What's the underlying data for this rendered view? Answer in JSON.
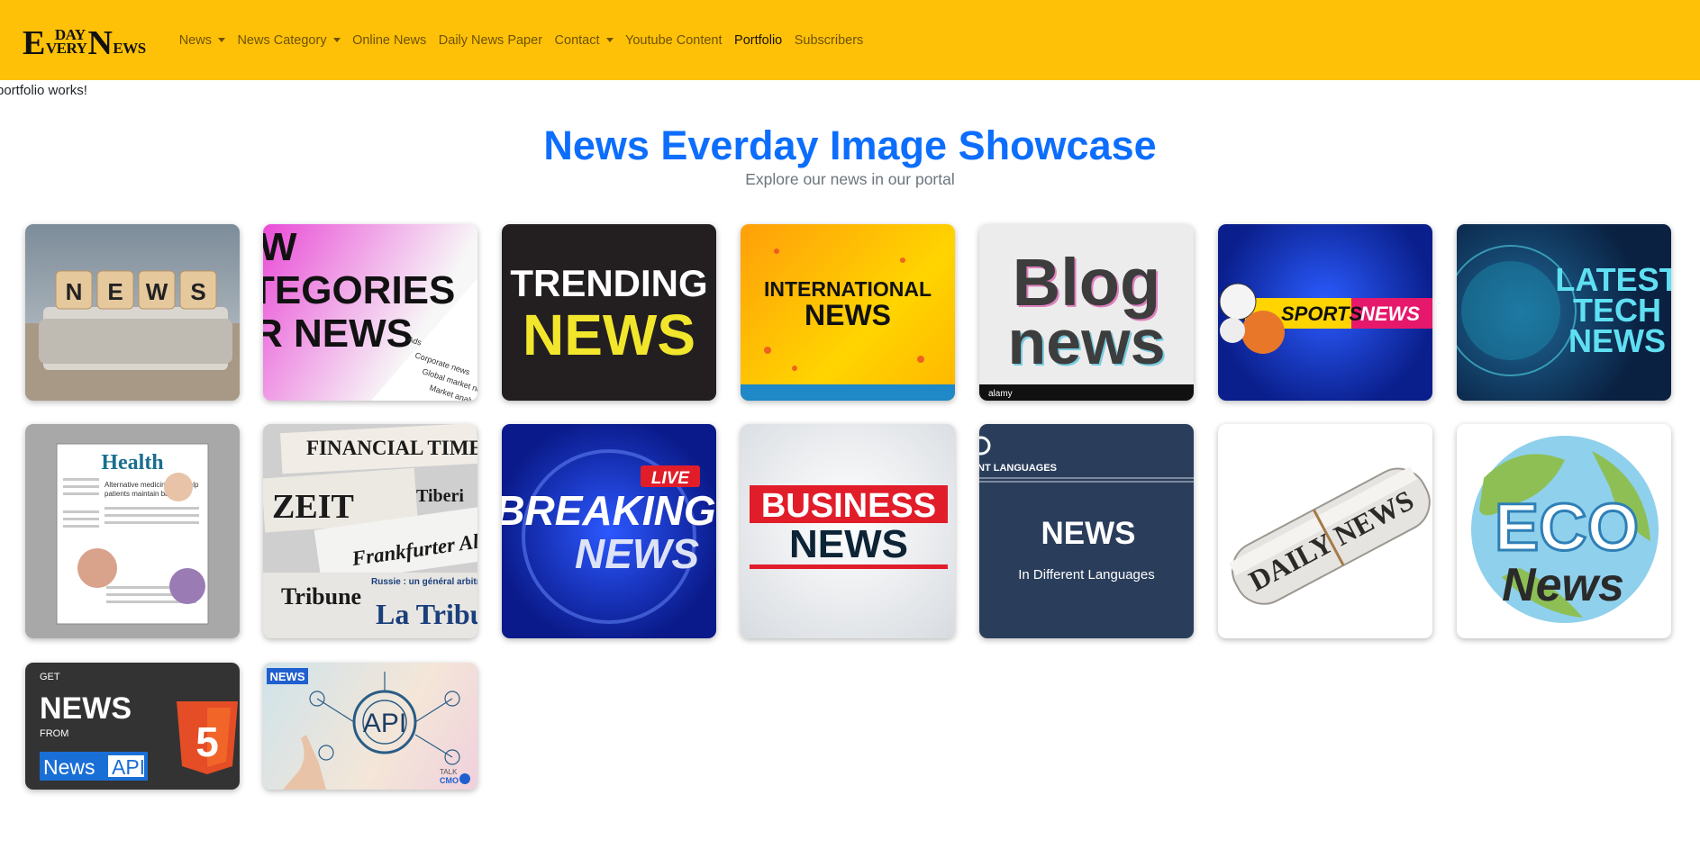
{
  "brand": {
    "big_letter_1": "E",
    "small_1": "DAY",
    "small_2": "VERY",
    "big_letter_2": "N",
    "small_3": "EWS"
  },
  "nav": {
    "items": [
      {
        "label": "News",
        "dropdown": true
      },
      {
        "label": "News Category",
        "dropdown": true
      },
      {
        "label": "Online News",
        "dropdown": false
      },
      {
        "label": "Daily News Paper",
        "dropdown": false
      },
      {
        "label": "Contact",
        "dropdown": true
      },
      {
        "label": "Youtube Content",
        "dropdown": false
      },
      {
        "label": "Portfolio",
        "dropdown": false,
        "active": true
      },
      {
        "label": "Subscribers",
        "dropdown": false
      }
    ]
  },
  "page": {
    "message": "portfolio works!"
  },
  "showcase": {
    "title": "News Everday Image Showcase",
    "subtitle": "Explore our news in our portal"
  },
  "tiles": [
    {
      "name": "news-cubes-image",
      "text": [
        "N",
        "E",
        "W",
        "S"
      ]
    },
    {
      "name": "news-categories-image",
      "text": [
        "W",
        "TEGORIES",
        "R NEWS",
        "Ads",
        "Corporate news",
        "Global market news",
        "Market analysis"
      ]
    },
    {
      "name": "trending-news-image",
      "text": [
        "TRENDING",
        "NEWS"
      ]
    },
    {
      "name": "international-news-image",
      "text": [
        "INTERNATIONAL",
        "NEWS"
      ]
    },
    {
      "name": "blog-news-image",
      "text": [
        "Blog",
        "news",
        "alamy"
      ]
    },
    {
      "name": "sports-news-image",
      "text": [
        "SPORTS",
        "NEWS"
      ]
    },
    {
      "name": "latest-tech-news-image",
      "text": [
        "LATEST",
        "TECH",
        "NEWS"
      ]
    },
    {
      "name": "health-newspaper-image",
      "text": [
        "Health",
        "Alternative medicine can help",
        "patients maintain balance"
      ]
    },
    {
      "name": "financial-newspapers-image",
      "text": [
        "FINANCIAL TIME",
        "ZEIT",
        "Frankfurter Allgem",
        "Tribune",
        "La Tribun",
        "Tiberi",
        "Russie : un général arbitre du"
      ]
    },
    {
      "name": "breaking-news-image",
      "text": [
        "LIVE",
        "BREAKING",
        "NEWS"
      ]
    },
    {
      "name": "business-news-image",
      "text": [
        "BUSINESS",
        "NEWS"
      ]
    },
    {
      "name": "languages-news-image",
      "text": [
        "NT LANGUAGES",
        "NEWS",
        "In Different Languages"
      ]
    },
    {
      "name": "daily-news-roll-image",
      "text": [
        "DAILY NEWS"
      ]
    },
    {
      "name": "eco-news-image",
      "text": [
        "ECO",
        "News"
      ]
    },
    {
      "name": "news-api-image",
      "text": [
        "GET",
        "NEWS",
        "FROM",
        "News",
        "API",
        "5"
      ]
    },
    {
      "name": "api-touch-image",
      "text": [
        "NEWS",
        "API",
        "TALK",
        "CMO"
      ]
    }
  ],
  "colors": {
    "navbar": "#ffc107",
    "title": "#0d6efd",
    "subtitle": "#6c757d"
  }
}
